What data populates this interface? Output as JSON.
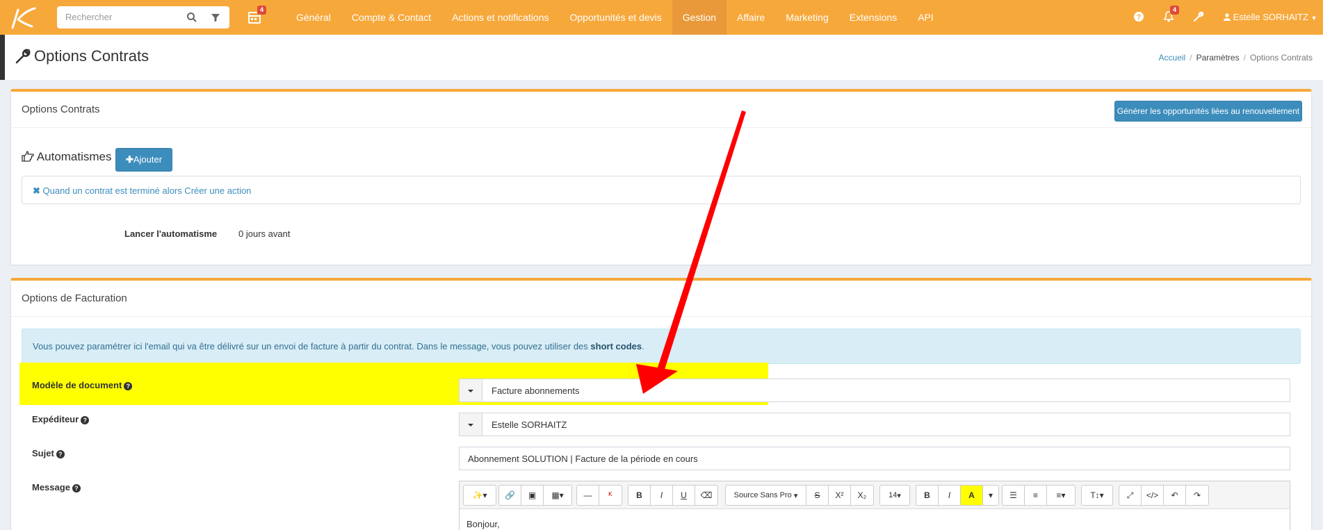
{
  "topbar": {
    "search_placeholder": "Rechercher",
    "calendar_badge": "4",
    "menu": [
      {
        "label": "Général"
      },
      {
        "label": "Compte & Contact"
      },
      {
        "label": "Actions et notifications"
      },
      {
        "label": "Opportunités et devis"
      },
      {
        "label": "Gestion",
        "active": true
      },
      {
        "label": "Affaire"
      },
      {
        "label": "Marketing"
      },
      {
        "label": "Extensions"
      },
      {
        "label": "API"
      }
    ],
    "notif_badge": "4",
    "user_name": "Estelle SORHAITZ",
    "accent_color": "#f7a83b"
  },
  "header": {
    "title": "Options Contrats",
    "breadcrumb": [
      "Accueil",
      "Paramètres",
      "Options Contrats"
    ]
  },
  "contracts_box": {
    "title": "Options Contrats",
    "renew_button": "Générer les opportunités liées au renouvellement",
    "automations_title": "Automatismes",
    "add_button": "Ajouter",
    "rule_text": "Quand un contrat est terminé alors Créer une action",
    "launch_label": "Lancer l'automatisme",
    "launch_value": "0 jours avant"
  },
  "billing_box": {
    "title": "Options de Facturation",
    "info_text": "Vous pouvez paramétrer ici l'email qui va être délivré sur un envoi de facture à partir du contrat. Dans le message, vous pouvez utiliser des",
    "info_link": "short codes",
    "info_end": ".",
    "fields": {
      "template_label": "Modèle de document",
      "template_value": "Facture abonnements",
      "sender_label": "Expéditeur",
      "sender_value": "Estelle SORHAITZ",
      "subject_label": "Sujet",
      "subject_value": "Abonnement SOLUTION | Facture de la période en cours",
      "message_label": "Message"
    },
    "editor": {
      "font_name": "Source Sans Pro",
      "font_size": "14",
      "body_text": "Bonjour,"
    }
  },
  "annotation": {
    "highlight_color": "#ffff00",
    "arrow_color": "#ff0000"
  }
}
